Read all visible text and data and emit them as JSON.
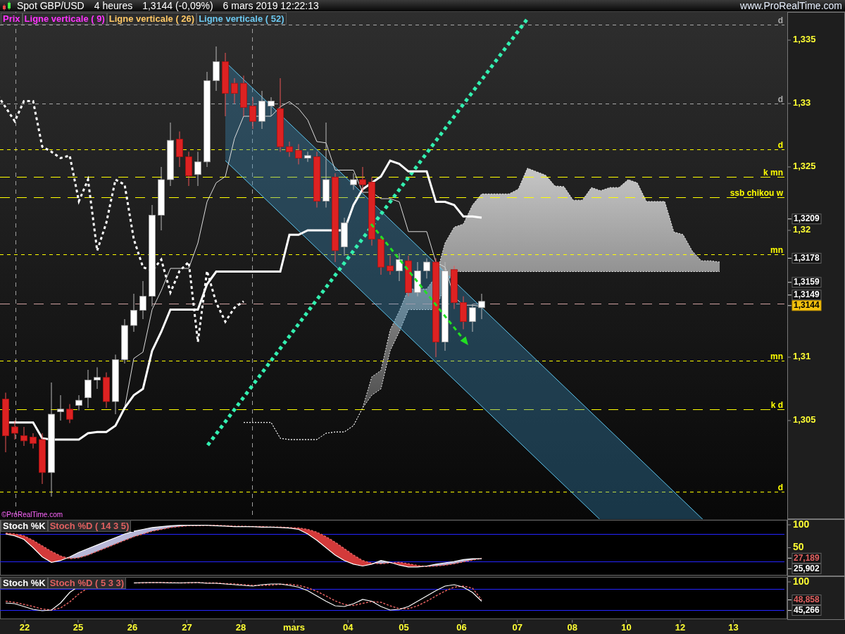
{
  "title_bar": {
    "symbol": "Spot GBP/USD",
    "timeframe": "4 heures",
    "price": "1,3144 (-0,09%)",
    "datetime": "6 mars 2019 12:22:13",
    "website": "www.ProRealTime.com"
  },
  "price_panel": {
    "legend": [
      {
        "label": "Prix",
        "color": "#ff33ff"
      },
      {
        "label": "Ligne verticale ( 9)",
        "color": "#ff33ff"
      },
      {
        "label": "Ligne verticale ( 26)",
        "color": "#ffc866"
      },
      {
        "label": "Ligne verticale ( 52)",
        "color": "#6cc8f0"
      }
    ],
    "copyright": "©ProRealTime.com",
    "axis_labels": [
      "1,335",
      "1,33",
      "1,325",
      "1,32",
      "1,31",
      "1,305"
    ],
    "levels": [
      {
        "label": "d",
        "color": "#a8a8a8"
      },
      {
        "label": "d",
        "color": "#a8a8a8"
      },
      {
        "label": "d",
        "color": "#ffff00"
      },
      {
        "label": "k mn",
        "color": "#ffff00"
      },
      {
        "label": "ssb chikou w",
        "color": "#ffff00"
      },
      {
        "label": "mn",
        "color": "#ffff00"
      },
      {
        "label": "mn",
        "color": "#ffff00"
      },
      {
        "label": "k d",
        "color": "#ffff00"
      },
      {
        "label": "d",
        "color": "#ffff00"
      }
    ],
    "price_tags": [
      {
        "label": "1,3209",
        "selected": false
      },
      {
        "label": "1,3178",
        "selected": false
      },
      {
        "label": "1,3159",
        "selected": false
      },
      {
        "label": "1,3149",
        "selected": false
      },
      {
        "label": "1,3144",
        "selected": true
      }
    ]
  },
  "stoch_panels": [
    {
      "legend": [
        {
          "label": "Stoch %K"
        },
        {
          "label": "Stoch %D ( 14 3 5)"
        }
      ],
      "axis_labels": [
        "100",
        "50"
      ],
      "value_tags": [
        {
          "label": "27,189",
          "color": "#e06060"
        },
        {
          "label": "25,902",
          "color": "#ffffff"
        }
      ]
    },
    {
      "legend": [
        {
          "label": "Stoch %K"
        },
        {
          "label": "Stoch %D ( 5 3 3)"
        }
      ],
      "axis_labels": [
        "100"
      ],
      "value_tags": [
        {
          "label": "48,858",
          "color": "#e06060"
        },
        {
          "label": "45,266",
          "color": "#ffffff"
        }
      ]
    }
  ],
  "x_axis": {
    "labels": [
      "22",
      "25",
      "26",
      "27",
      "28",
      "mars",
      "04",
      "05",
      "06",
      "07",
      "08",
      "10",
      "12",
      "13"
    ]
  }
}
